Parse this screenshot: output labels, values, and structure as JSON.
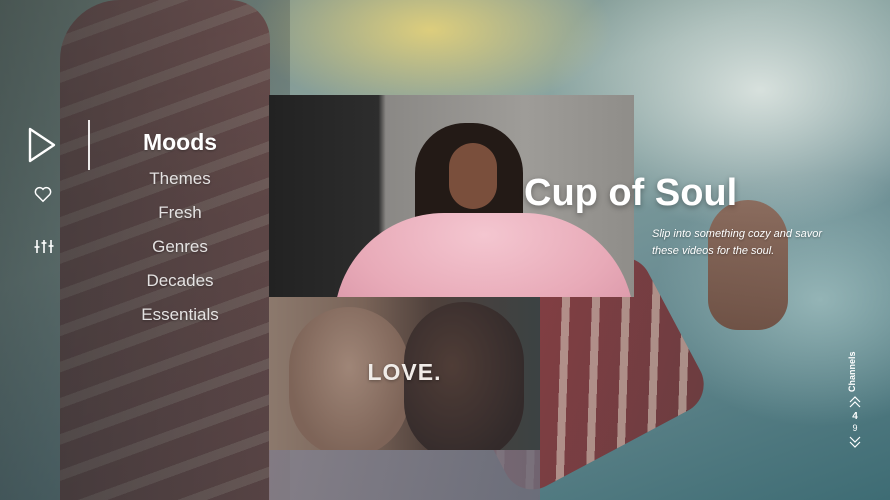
{
  "rail": {
    "icons": [
      "play-icon",
      "heart-icon",
      "equalizer-icon"
    ]
  },
  "menu": {
    "items": [
      "Moods",
      "Themes",
      "Fresh",
      "Genres",
      "Decades",
      "Essentials"
    ],
    "active": "Moods"
  },
  "tiles": {
    "middle_label": "LOVE."
  },
  "feature": {
    "title": "Cup of Soul",
    "description": "Slip into something cozy and savor these videos for the soul."
  },
  "channels": {
    "label": "Channels",
    "current": "4",
    "next": "9"
  },
  "colors": {
    "text": "#ffffff",
    "coat_pink": "#f4c6d0"
  }
}
